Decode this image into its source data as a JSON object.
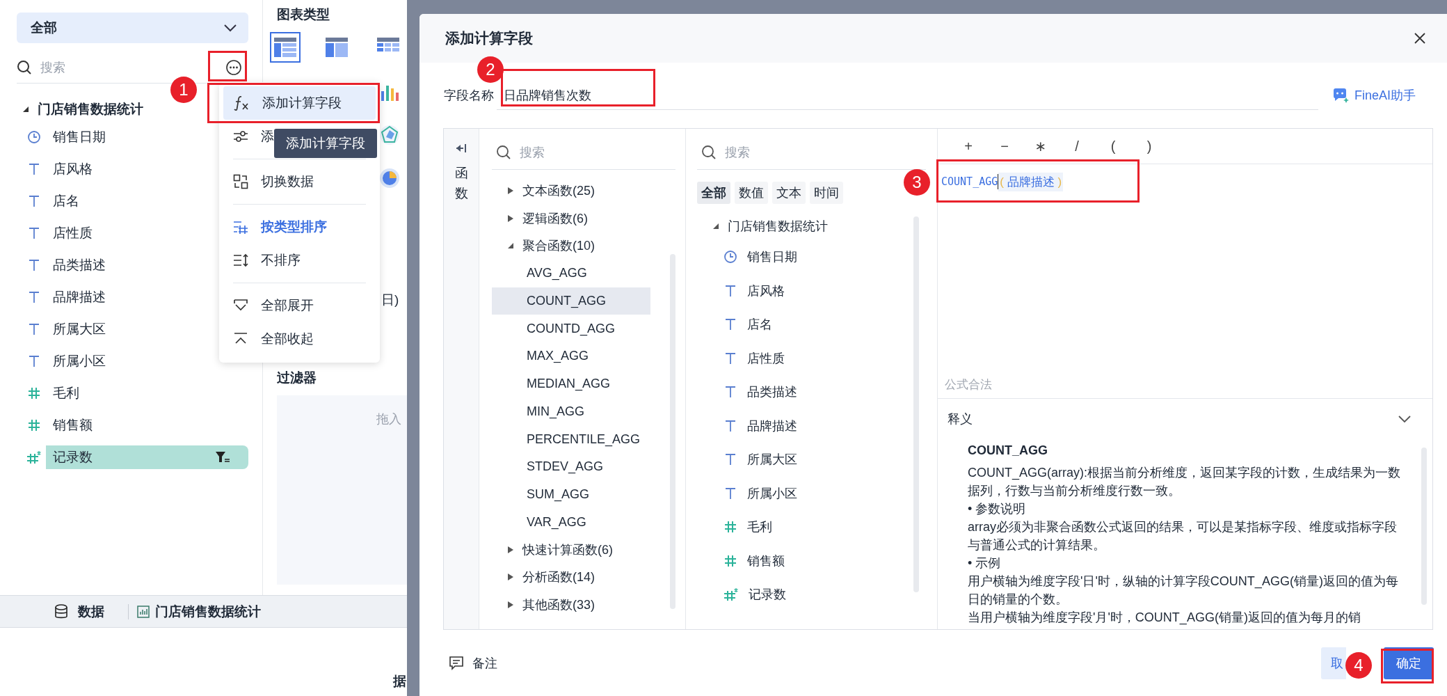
{
  "sidebar": {
    "dropdown": "全部",
    "search_placeholder": "搜索",
    "tree": {
      "label": "门店销售数据统计",
      "expanded": true,
      "children": [
        {
          "label": "销售日期",
          "kind": "date",
          "selected": false
        },
        {
          "label": "店风格",
          "kind": "text",
          "selected": false
        },
        {
          "label": "店名",
          "kind": "text",
          "selected": false
        },
        {
          "label": "店性质",
          "kind": "text",
          "selected": false
        },
        {
          "label": "品类描述",
          "kind": "text",
          "selected": false
        },
        {
          "label": "品牌描述",
          "kind": "text",
          "selected": false
        },
        {
          "label": "所属大区",
          "kind": "text",
          "selected": false
        },
        {
          "label": "所属小区",
          "kind": "text",
          "selected": false
        },
        {
          "label": "毛利",
          "kind": "number",
          "selected": false
        },
        {
          "label": "销售额",
          "kind": "number",
          "selected": false
        },
        {
          "label": "记录数",
          "kind": "count",
          "selected": true
        }
      ]
    }
  },
  "chart_panel": {
    "title": "图表类型",
    "chart_types": [
      {
        "kind": "table",
        "selected": true
      },
      {
        "kind": "crosstable",
        "selected": false
      },
      {
        "kind": "detail",
        "selected": false
      },
      {
        "kind": "bar",
        "selected": false
      },
      {
        "kind": "radar",
        "selected": false
      },
      {
        "kind": "pie",
        "selected": false
      }
    ],
    "fragment": "日)",
    "filter_title": "过滤器",
    "filter_hint": "拖入",
    "bottom_fragment": "据"
  },
  "more_menu": {
    "items": [
      {
        "kind": "item",
        "label": "添加计算字段",
        "highlighted": true,
        "selected": false
      },
      {
        "kind": "item",
        "label": "添",
        "highlighted": false,
        "selected": false
      },
      {
        "kind": "divider"
      },
      {
        "kind": "item",
        "label": "切换数据",
        "highlighted": false,
        "selected": false
      },
      {
        "kind": "divider"
      },
      {
        "kind": "item",
        "label": "按类型排序",
        "highlighted": false,
        "selected": true
      },
      {
        "kind": "item",
        "label": "不排序",
        "highlighted": false,
        "selected": false
      },
      {
        "kind": "divider"
      },
      {
        "kind": "item",
        "label": "全部展开",
        "highlighted": false,
        "selected": false
      },
      {
        "kind": "item",
        "label": "全部收起",
        "highlighted": false,
        "selected": false
      }
    ],
    "tooltip": "添加计算字段"
  },
  "bottom_tabs": [
    {
      "label": "数据"
    },
    {
      "label": "门店销售数据统计"
    }
  ],
  "dialog": {
    "title": "添加计算字段",
    "field_name": {
      "label": "字段名称",
      "value": "日品牌销售次数"
    },
    "assistant": "FineAI助手",
    "function_panel": {
      "side_label": "函数",
      "search_placeholder": "搜索",
      "categories": [
        {
          "label": "文本函数(25)",
          "expanded": false
        },
        {
          "label": "逻辑函数(6)",
          "expanded": false
        },
        {
          "label": "聚合函数(10)",
          "expanded": true,
          "children": [
            {
              "label": "AVG_AGG",
              "selected": false
            },
            {
              "label": "COUNT_AGG",
              "selected": true
            },
            {
              "label": "COUNTD_AGG",
              "selected": false
            },
            {
              "label": "MAX_AGG",
              "selected": false
            },
            {
              "label": "MEDIAN_AGG",
              "selected": false
            },
            {
              "label": "MIN_AGG",
              "selected": false
            },
            {
              "label": "PERCENTILE_AGG",
              "selected": false
            },
            {
              "label": "STDEV_AGG",
              "selected": false
            },
            {
              "label": "SUM_AGG",
              "selected": false
            },
            {
              "label": "VAR_AGG",
              "selected": false
            }
          ]
        },
        {
          "label": "快速计算函数(6)",
          "expanded": false
        },
        {
          "label": "分析函数(14)",
          "expanded": false
        },
        {
          "label": "其他函数(33)",
          "expanded": false
        }
      ]
    },
    "field_panel": {
      "search_placeholder": "搜索",
      "filters": [
        {
          "label": "全部",
          "selected": true
        },
        {
          "label": "数值",
          "selected": false
        },
        {
          "label": "文本",
          "selected": false
        },
        {
          "label": "时间",
          "selected": false
        }
      ],
      "tree": {
        "label": "门店销售数据统计",
        "expanded": true,
        "children": [
          {
            "label": "销售日期",
            "kind": "date"
          },
          {
            "label": "店风格",
            "kind": "text"
          },
          {
            "label": "店名",
            "kind": "text"
          },
          {
            "label": "店性质",
            "kind": "text"
          },
          {
            "label": "品类描述",
            "kind": "text"
          },
          {
            "label": "品牌描述",
            "kind": "text"
          },
          {
            "label": "所属大区",
            "kind": "text"
          },
          {
            "label": "所属小区",
            "kind": "text"
          },
          {
            "label": "毛利",
            "kind": "number"
          },
          {
            "label": "销售额",
            "kind": "number"
          },
          {
            "label": "记录数",
            "kind": "count"
          }
        ]
      }
    },
    "editor": {
      "operators": [
        "+",
        "−",
        "∗",
        "/",
        "(",
        ")"
      ],
      "formula": {
        "function": "COUNT_AGG",
        "open": "(",
        "field": "品牌描述",
        "close": ")"
      },
      "status": "公式合法"
    },
    "explanation": {
      "title": "释义",
      "expanded": true,
      "heading": "COUNT_AGG",
      "paragraphs": [
        "COUNT_AGG(array):根据当前分析维度，返回某字段的计数，生成结果为一数据列，行数与当前分析维度行数一致。",
        "• 参数说明",
        "array必须为非聚合函数公式返回的结果，可以是某指标字段、维度或指标字段与普通公式的计算结果。",
        "• 示例",
        "用户横轴为维度字段'日'时，纵轴的计算字段COUNT_AGG(销量)返回的值为每日的销量的个数。",
        "当用户横轴为维度字段'月'时，COUNT_AGG(销量)返回的值为每月的销"
      ]
    },
    "note": "备注",
    "buttons": [
      {
        "label": "取",
        "kind": "secondary"
      },
      {
        "label": "确定",
        "kind": "primary"
      }
    ]
  },
  "annotations": [
    {
      "label": "1"
    },
    {
      "label": "2"
    },
    {
      "label": "3"
    },
    {
      "label": "4"
    }
  ]
}
